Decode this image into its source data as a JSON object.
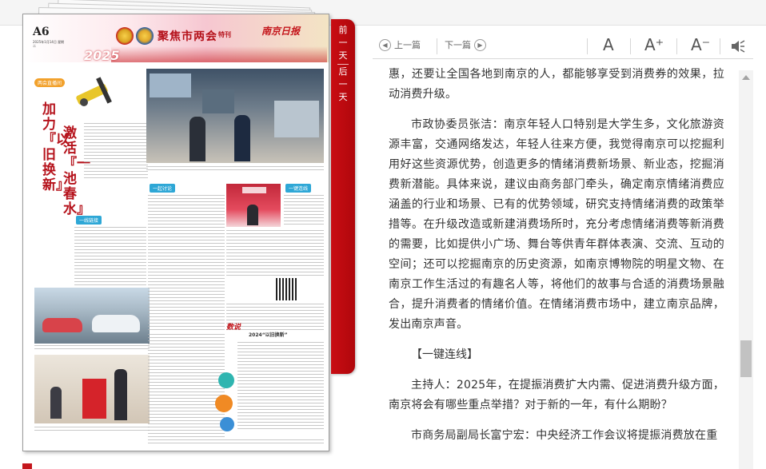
{
  "newspaper": {
    "page_number": "A6",
    "page_date": "2025年1月14日 星期二",
    "section_title": "聚焦市两会",
    "special_label": "特刊",
    "paper_logo": "南京日报",
    "year_banner": "2025",
    "headline_lines": [
      "加力『以旧换新』",
      "激活『一池春水』"
    ],
    "tags": [
      "两会直播间",
      "一起讨论",
      "一线链接",
      "一键连线",
      "两会直播间"
    ],
    "data_heading": "数说",
    "data_title": "2024“以旧换新”"
  },
  "side_nav": {
    "prev_day": "前一天",
    "next_day": "后一天"
  },
  "toolbar": {
    "prev_article": "上一篇",
    "next_article": "下一篇",
    "font_default": "A",
    "font_larger": "A⁺",
    "font_smaller": "A⁻",
    "speaker_icon": "speaker-icon"
  },
  "article": {
    "para1": "加大消费券的发放力度和范围，不仅让南京人能够享受到消费优惠，还要让全国各地到南京的人，都能够享受到消费券的效果，拉动消费升级。",
    "para2": "市政协委员张洁：南京年轻人口特别是大学生多，文化旅游资源丰富，交通网络发达，年轻人往来方便，我觉得南京可以挖掘利用好这些资源优势，创造更多的情绪消费新场景、新业态，挖掘消费新潜能。具体来说，建议由商务部门牵头，确定南京情绪消费应涵盖的行业和场景、已有的优势领域，研究支持情绪消费的政策举措等。在升级改造或新建消费场所时，充分考虑情绪消费等新消费的需要，比如提供小广场、舞台等供青年群体表演、交流、互动的空间；还可以挖掘南京的历史资源，如南京博物院的明星文物、在南京工作生活过的有趣名人等，将他们的故事与合适的消费场景融合，提升消费者的情绪价值。在情绪消费市场中，建立南京品牌，发出南京声音。",
    "subhead": "【一键连线】",
    "para3": "主持人：2025年，在提振消费扩大内需、促进消费升级方面，南京将会有哪些重点举措？对于新的一年，有什么期盼？",
    "para4": "市商务局副局长富宁宏：中央经济工作会议将提振消费放在重"
  },
  "colors": {
    "brand_red": "#c4161c",
    "text": "#333333",
    "tag_blue": "#2ea7d6"
  }
}
